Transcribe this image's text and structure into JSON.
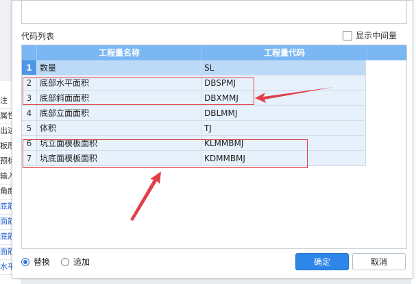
{
  "background_app": {
    "left_items": [
      {
        "text": "注",
        "blue": false
      },
      {
        "text": "属性",
        "blue": false
      },
      {
        "text": "出边",
        "blue": false
      },
      {
        "text": "板厚",
        "blue": false
      },
      {
        "text": "预标",
        "blue": false
      },
      {
        "text": "输入",
        "blue": false
      },
      {
        "text": "角度",
        "blue": false
      },
      {
        "text": "底筋",
        "blue": true
      },
      {
        "text": "面筋",
        "blue": true
      },
      {
        "text": "底筋",
        "blue": true
      },
      {
        "text": "面筋",
        "blue": true
      },
      {
        "text": "水平筋",
        "blue": true
      }
    ]
  },
  "dialog": {
    "section_label": "代码列表",
    "show_intermediate_label": "显示中间量",
    "table": {
      "headers": [
        "工程量名称",
        "工程量代码"
      ],
      "rows": [
        {
          "index": "1",
          "name": "数量",
          "code": "SL",
          "selected": true
        },
        {
          "index": "2",
          "name": "底部水平面积",
          "code": "DBSPMJ"
        },
        {
          "index": "3",
          "name": "底部斜面面积",
          "code": "DBXMMJ"
        },
        {
          "index": "4",
          "name": "底部立面面积",
          "code": "DBLMMJ"
        },
        {
          "index": "5",
          "name": "体积",
          "code": "TJ"
        },
        {
          "index": "6",
          "name": "坑立面模板面积",
          "code": "KLMMBMJ"
        },
        {
          "index": "7",
          "name": "坑底面模板面积",
          "code": "KDMMBMJ"
        }
      ]
    },
    "radio_replace_label": "替换",
    "radio_append_label": "追加",
    "ok_label": "确定",
    "cancel_label": "取消"
  },
  "colors": {
    "header_blue": "#7ab7f3",
    "selected_blue": "#4d97e6",
    "annotation_red": "#e0404a",
    "ok_button": "#2d86e8"
  }
}
